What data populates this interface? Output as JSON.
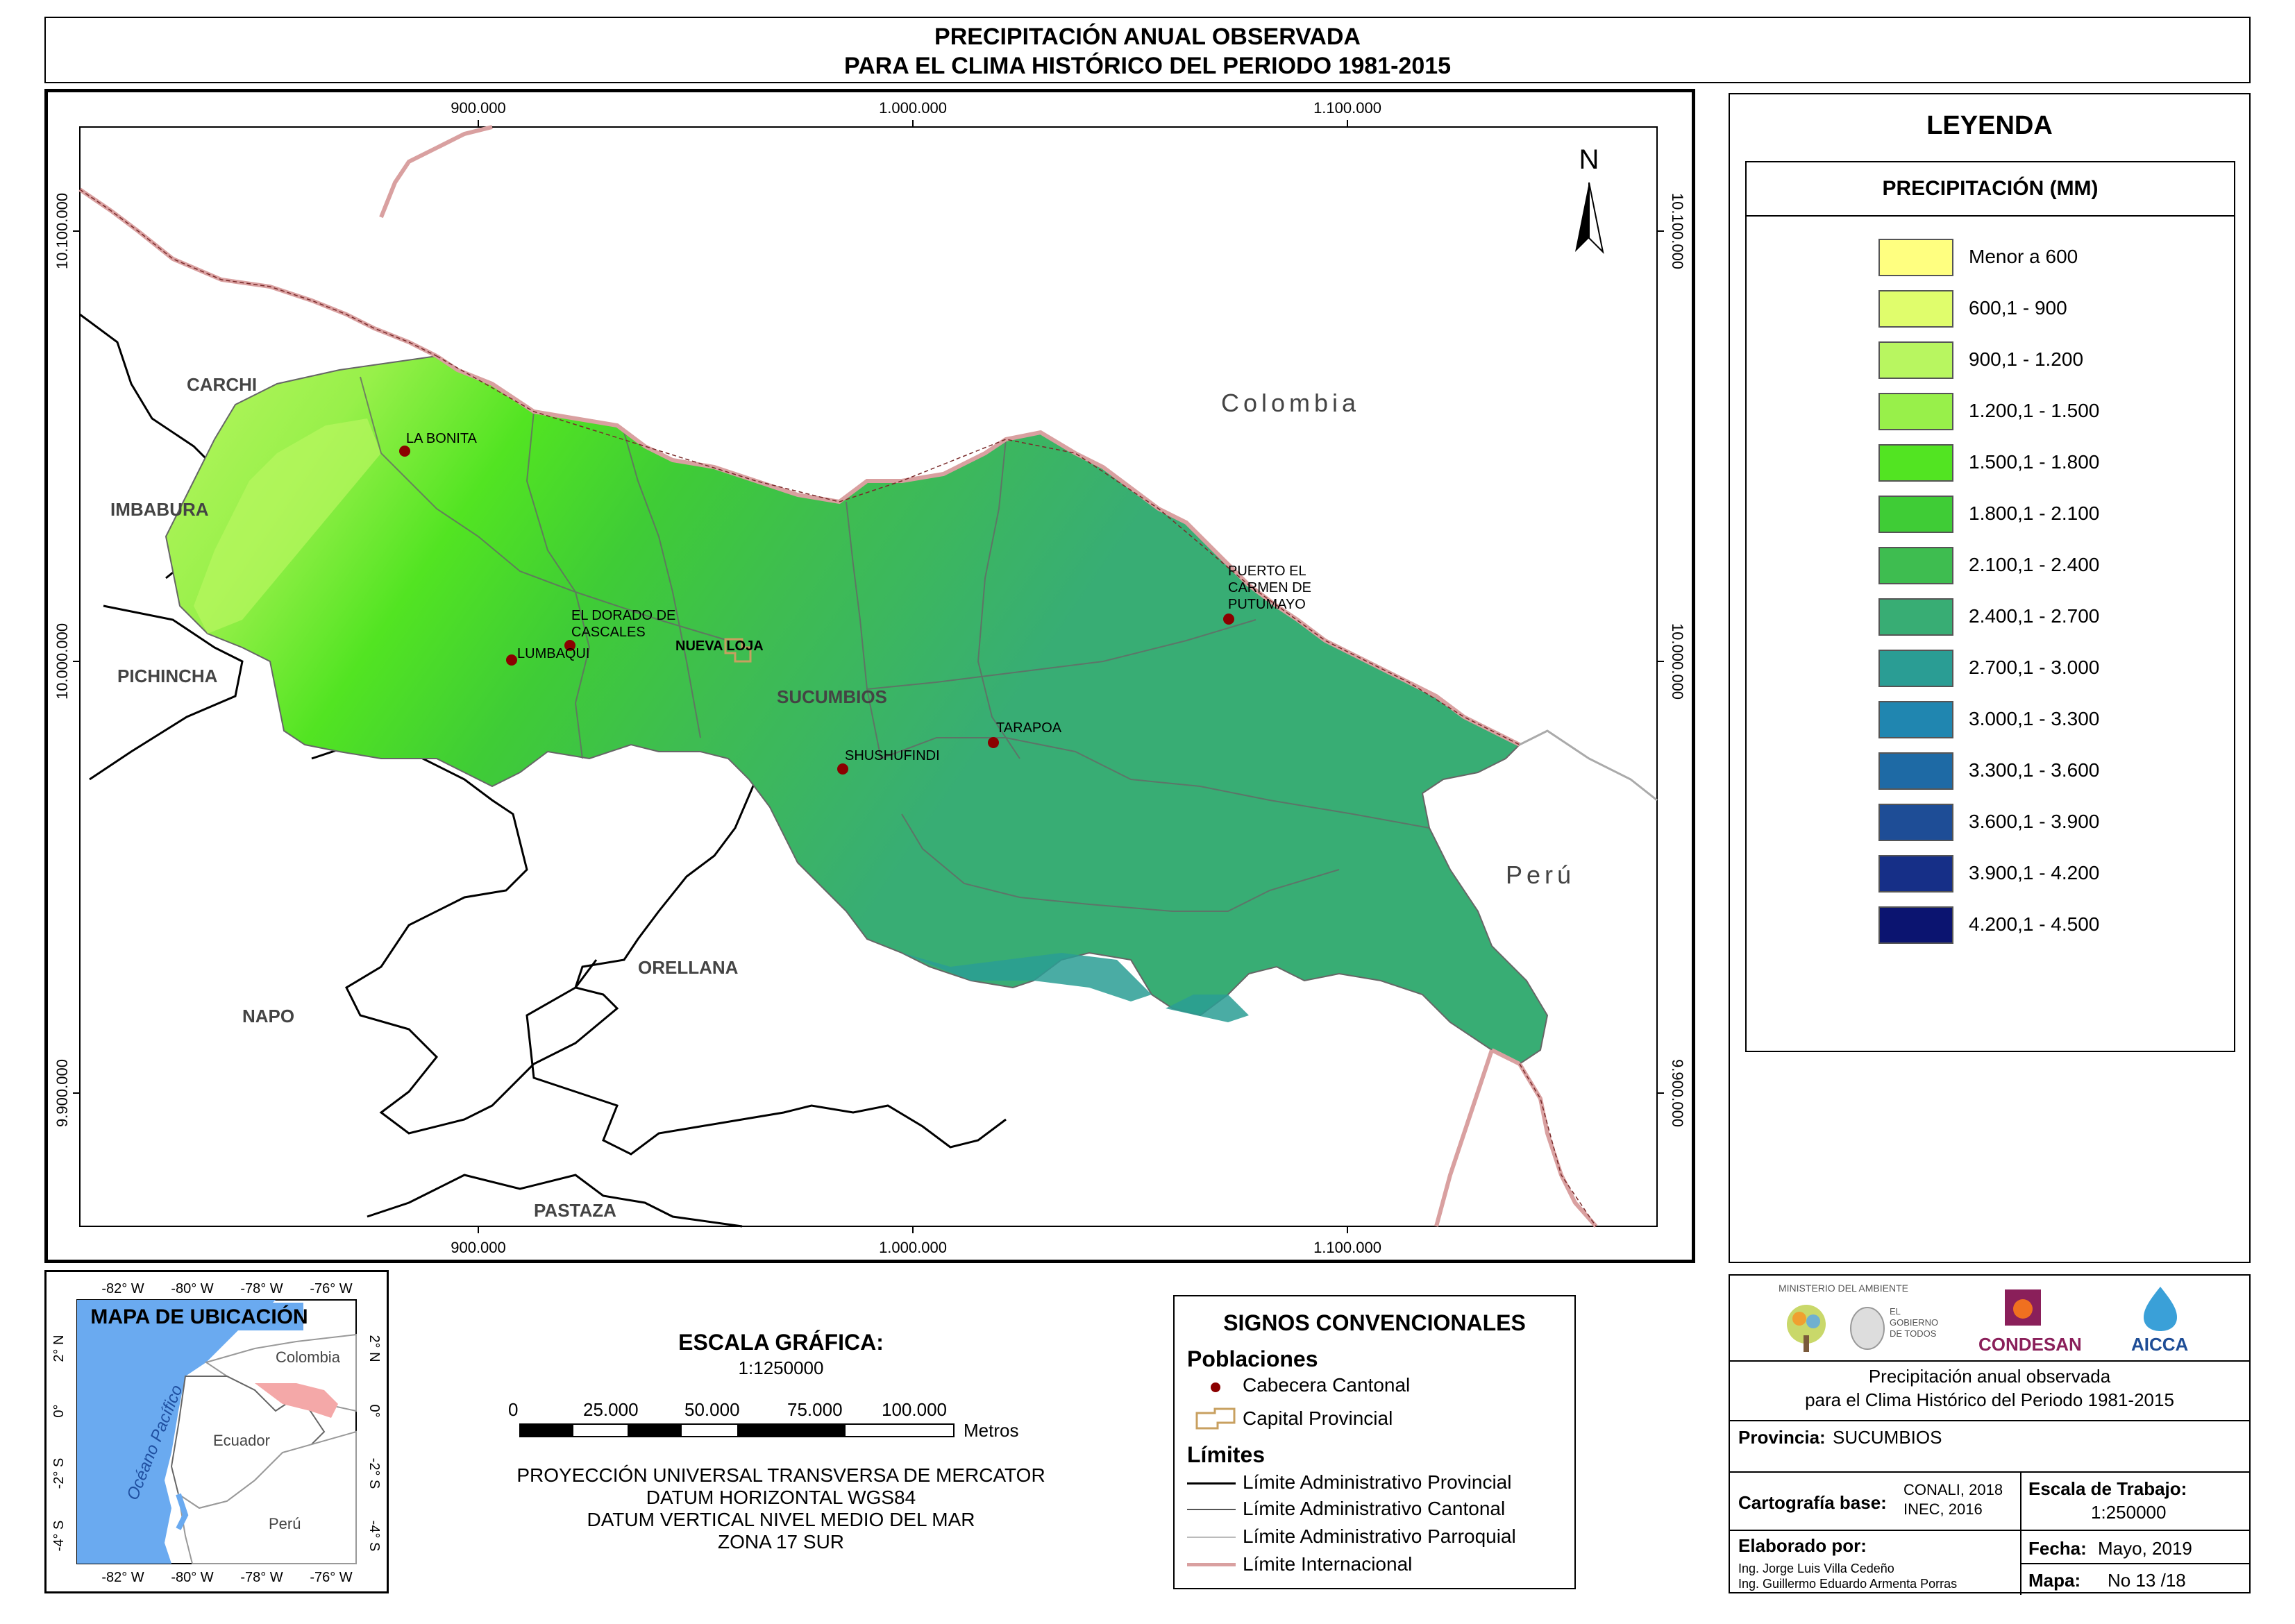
{
  "title": {
    "line1": "PRECIPITACIÓN ANUAL OBSERVADA",
    "line2": "PARA EL CLIMA HISTÓRICO DEL PERIODO 1981-2015"
  },
  "map": {
    "x_ticks": [
      "900.000",
      "1.000.000",
      "1.100.000"
    ],
    "y_ticks": [
      "10.100.000",
      "10.000.000",
      "9.900.000"
    ],
    "north": "N",
    "countries": {
      "colombia": "Colombia",
      "peru": "Perú"
    },
    "provinces": {
      "carchi": "CARCHI",
      "imbabura": "IMBABURA",
      "pichincha": "PICHINCHA",
      "napo": "NAPO",
      "orellana": "ORELLANA",
      "pastaza": "PASTAZA",
      "sucumbios": "SUCUMBIOS"
    },
    "towns": {
      "la_bonita": "LA BONITA",
      "el_dorado_1": "EL DORADO DE",
      "el_dorado_2": "CASCALES",
      "lumbaqui": "LUMBAQUI",
      "nueva_loja": "NUEVA LOJA",
      "puerto_1": "PUERTO EL",
      "puerto_2": "CARMEN DE",
      "puerto_3": "PUTUMAYO",
      "tarapoa": "TARAPOA",
      "shushufindi": "SHUSHUFINDI"
    }
  },
  "legend": {
    "title": "LEYENDA",
    "subtitle": "PRECIPITACIÓN (MM)",
    "items": [
      {
        "label": "Menor a 600",
        "color": "#ffff80"
      },
      {
        "label": "600,1 - 900",
        "color": "#e0fd6c"
      },
      {
        "label": "900,1 - 1.200",
        "color": "#b8f660"
      },
      {
        "label": "1.200,1 - 1.500",
        "color": "#98f04a"
      },
      {
        "label": "1.500,1 - 1.800",
        "color": "#52e422"
      },
      {
        "label": "1.800,1 - 2.100",
        "color": "#3fcc36"
      },
      {
        "label": "2.100,1 - 2.400",
        "color": "#3ebd50"
      },
      {
        "label": "2.400,1 - 2.700",
        "color": "#38ad74"
      },
      {
        "label": "2.700,1 - 3.000",
        "color": "#2a9d94"
      },
      {
        "label": "3.000,1 - 3.300",
        "color": "#2086b0"
      },
      {
        "label": "3.300,1 - 3.600",
        "color": "#1e6aa5"
      },
      {
        "label": "3.600,1 - 3.900",
        "color": "#1e4d96"
      },
      {
        "label": "3.900,1 - 4.200",
        "color": "#162f87"
      },
      {
        "label": "4.200,1 - 4.500",
        "color": "#0b1470"
      }
    ]
  },
  "location_map": {
    "title": "MAPA DE UBICACIÓN",
    "lon_ticks": [
      "-82° W",
      "-80° W",
      "-78° W",
      "-76° W"
    ],
    "lat_ticks": [
      "2° N",
      "0°",
      "-2° S",
      "-4° S"
    ],
    "ocean": "Océano Pacífico",
    "colombia": "Colombia",
    "ecuador": "Ecuador",
    "peru": "Perú"
  },
  "scale": {
    "title": "ESCALA GRÁFICA:",
    "ratio": "1:1250000",
    "ticks": [
      "0",
      "25.000",
      "50.000",
      "75.000",
      "100.000"
    ],
    "unit": "Metros",
    "proj": [
      "PROYECCIÓN UNIVERSAL TRANSVERSA DE MERCATOR",
      "DATUM HORIZONTAL WGS84",
      "DATUM VERTICAL NIVEL MEDIO DEL MAR",
      "ZONA 17 SUR"
    ]
  },
  "signs": {
    "title": "SIGNOS CONVENCIONALES",
    "pop_header": "Poblaciones",
    "cabecera": "Cabecera Cantonal",
    "capital": "Capital Provincial",
    "lim_header": "Límites",
    "lim_prov": "Límite Administrativo Provincial",
    "lim_cant": "Límite Administrativo Cantonal",
    "lim_parr": "Límite Administrativo Parroquial",
    "lim_int": "Límite Internacional"
  },
  "info": {
    "ministerio": "MINISTERIO DEL AMBIENTE",
    "gobierno_1": "EL",
    "gobierno_2": "GOBIERNO",
    "gobierno_3": "DE TODOS",
    "condesan": "CONDESAN",
    "aicca": "AICCA",
    "desc1": "Precipitación anual observada",
    "desc2": "para el Clima Histórico del Periodo 1981-2015",
    "prov_label": "Provincia:",
    "prov_value": "SUCUMBIOS",
    "carto_label": "Cartografía base:",
    "carto_1": "CONALI, 2018",
    "carto_2": "INEC, 2016",
    "escala_label": "Escala de Trabajo:",
    "escala_value": "1:250000",
    "elab_label": "Elaborado por:",
    "elab_1": "Ing. Jorge Luis Villa Cedeño",
    "elab_2": "Ing. Guillermo Eduardo Armenta Porras",
    "fecha_label": "Fecha:",
    "fecha_value": "Mayo, 2019",
    "mapa_label": "Mapa:",
    "mapa_value": "No 13 /18"
  }
}
